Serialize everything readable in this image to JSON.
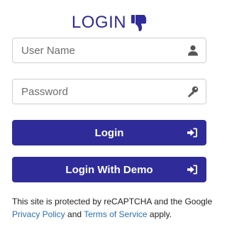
{
  "header": {
    "title": "LOGIN",
    "title_icon": "thumbs-down-icon"
  },
  "form": {
    "username": {
      "placeholder": "User Name",
      "value": "",
      "icon": "user-icon"
    },
    "password": {
      "placeholder": "Password",
      "value": "",
      "icon": "key-icon"
    },
    "login_button": {
      "label": "Login",
      "icon": "sign-in-icon"
    },
    "demo_button": {
      "label": "Login With Demo",
      "icon": "sign-in-icon"
    }
  },
  "recaptcha": {
    "text_before": "This site is protected by reCAPTCHA and the Google",
    "privacy_link": "Privacy Policy",
    "text_and": "and",
    "terms_link": "Terms of Service",
    "text_after": "apply."
  },
  "colors": {
    "brand": "#2f2c9a",
    "link": "#2a6fb0",
    "icon_gray": "#555555"
  }
}
